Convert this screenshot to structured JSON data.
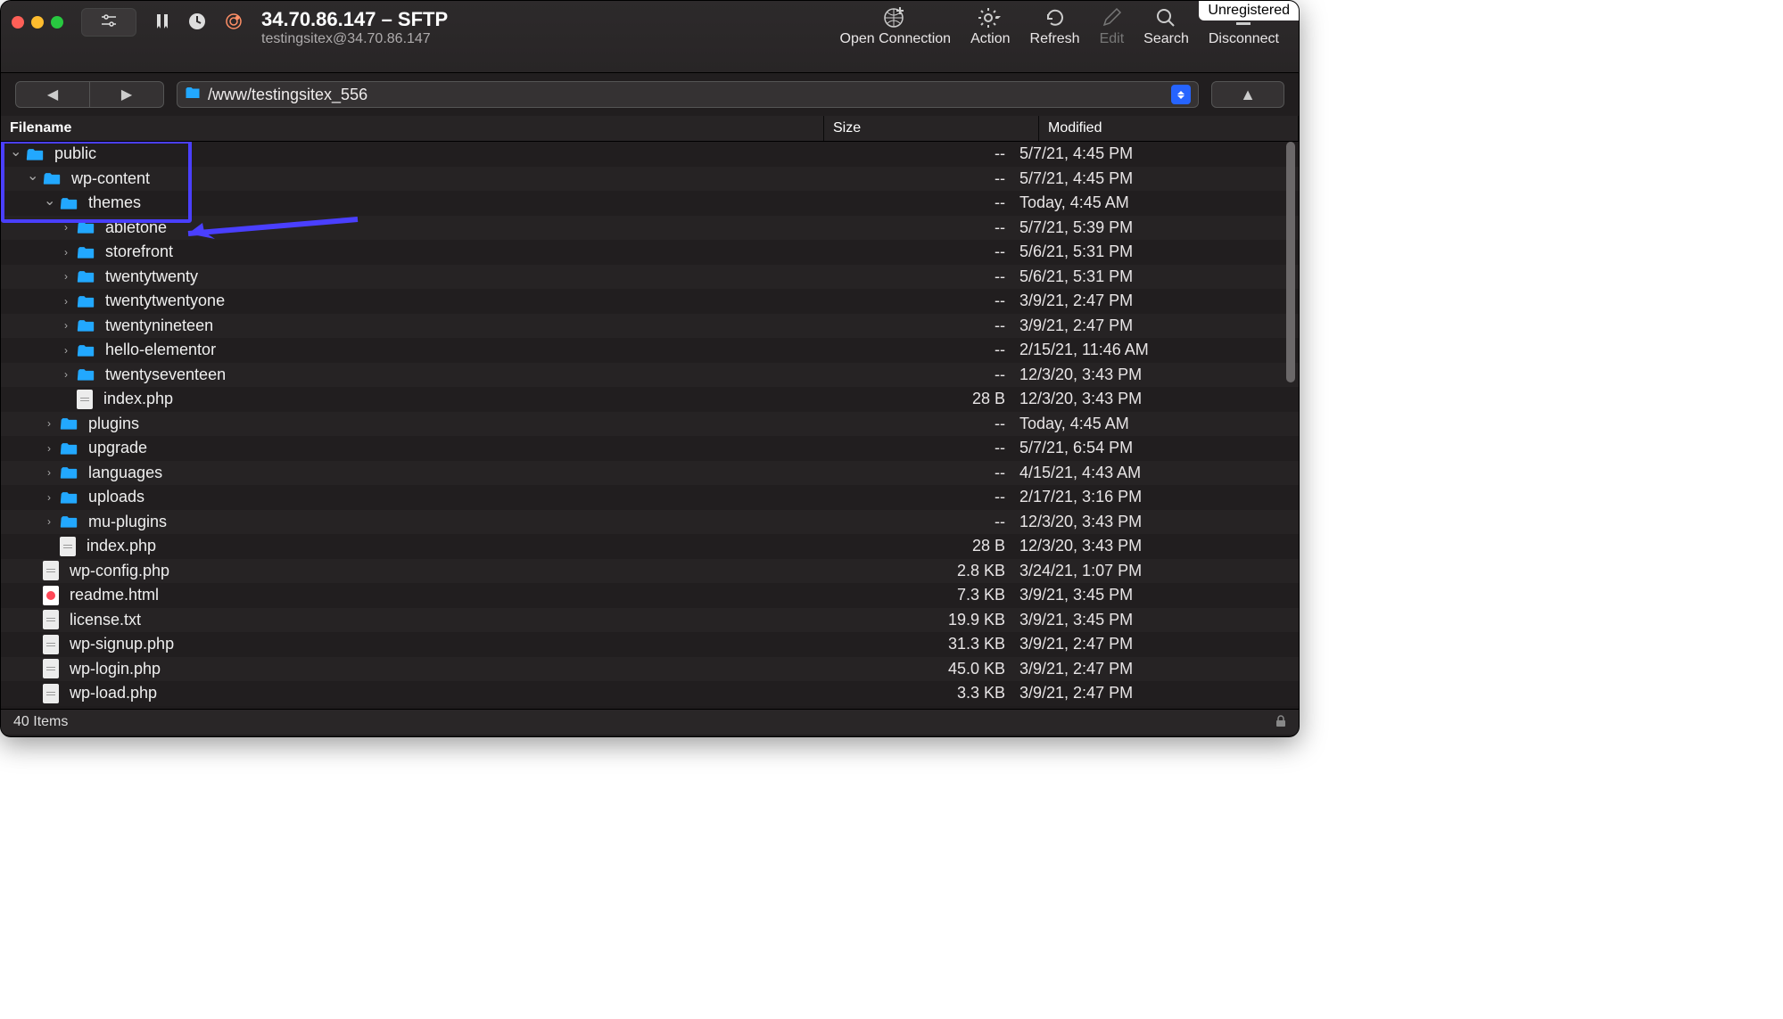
{
  "window": {
    "title": "34.70.86.147 – SFTP",
    "subtitle": "testingsitex@34.70.86.147",
    "unregistered": "Unregistered"
  },
  "toolbar": {
    "open_connection": "Open Connection",
    "action": "Action",
    "refresh": "Refresh",
    "edit": "Edit",
    "search": "Search",
    "disconnect": "Disconnect"
  },
  "path": "/www/testingsitex_556",
  "columns": {
    "filename": "Filename",
    "size": "Size",
    "modified": "Modified"
  },
  "rows": [
    {
      "indent": 0,
      "chev": "down",
      "type": "folder",
      "name": "public",
      "size": "--",
      "modified": "5/7/21, 4:45 PM"
    },
    {
      "indent": 1,
      "chev": "down",
      "type": "folder",
      "name": "wp-content",
      "size": "--",
      "modified": "5/7/21, 4:45 PM"
    },
    {
      "indent": 2,
      "chev": "down",
      "type": "folder",
      "name": "themes",
      "size": "--",
      "modified": "Today, 4:45 AM"
    },
    {
      "indent": 3,
      "chev": "right",
      "type": "folder",
      "name": "abletone",
      "size": "--",
      "modified": "5/7/21, 5:39 PM"
    },
    {
      "indent": 3,
      "chev": "right",
      "type": "folder",
      "name": "storefront",
      "size": "--",
      "modified": "5/6/21, 5:31 PM"
    },
    {
      "indent": 3,
      "chev": "right",
      "type": "folder",
      "name": "twentytwenty",
      "size": "--",
      "modified": "5/6/21, 5:31 PM"
    },
    {
      "indent": 3,
      "chev": "right",
      "type": "folder",
      "name": "twentytwentyone",
      "size": "--",
      "modified": "3/9/21, 2:47 PM"
    },
    {
      "indent": 3,
      "chev": "right",
      "type": "folder",
      "name": "twentynineteen",
      "size": "--",
      "modified": "3/9/21, 2:47 PM"
    },
    {
      "indent": 3,
      "chev": "right",
      "type": "folder",
      "name": "hello-elementor",
      "size": "--",
      "modified": "2/15/21, 11:46 AM"
    },
    {
      "indent": 3,
      "chev": "right",
      "type": "folder",
      "name": "twentyseventeen",
      "size": "--",
      "modified": "12/3/20, 3:43 PM"
    },
    {
      "indent": 3,
      "chev": "none",
      "type": "file",
      "name": "index.php",
      "size": "28 B",
      "modified": "12/3/20, 3:43 PM"
    },
    {
      "indent": 2,
      "chev": "right",
      "type": "folder",
      "name": "plugins",
      "size": "--",
      "modified": "Today, 4:45 AM"
    },
    {
      "indent": 2,
      "chev": "right",
      "type": "folder",
      "name": "upgrade",
      "size": "--",
      "modified": "5/7/21, 6:54 PM"
    },
    {
      "indent": 2,
      "chev": "right",
      "type": "folder",
      "name": "languages",
      "size": "--",
      "modified": "4/15/21, 4:43 AM"
    },
    {
      "indent": 2,
      "chev": "right",
      "type": "folder",
      "name": "uploads",
      "size": "--",
      "modified": "2/17/21, 3:16 PM"
    },
    {
      "indent": 2,
      "chev": "right",
      "type": "folder",
      "name": "mu-plugins",
      "size": "--",
      "modified": "12/3/20, 3:43 PM"
    },
    {
      "indent": 2,
      "chev": "none",
      "type": "file",
      "name": "index.php",
      "size": "28 B",
      "modified": "12/3/20, 3:43 PM"
    },
    {
      "indent": 1,
      "chev": "none",
      "type": "file",
      "name": "wp-config.php",
      "size": "2.8 KB",
      "modified": "3/24/21, 1:07 PM"
    },
    {
      "indent": 1,
      "chev": "none",
      "type": "html",
      "name": "readme.html",
      "size": "7.3 KB",
      "modified": "3/9/21, 3:45 PM"
    },
    {
      "indent": 1,
      "chev": "none",
      "type": "file",
      "name": "license.txt",
      "size": "19.9 KB",
      "modified": "3/9/21, 3:45 PM"
    },
    {
      "indent": 1,
      "chev": "none",
      "type": "file",
      "name": "wp-signup.php",
      "size": "31.3 KB",
      "modified": "3/9/21, 2:47 PM"
    },
    {
      "indent": 1,
      "chev": "none",
      "type": "file",
      "name": "wp-login.php",
      "size": "45.0 KB",
      "modified": "3/9/21, 2:47 PM"
    },
    {
      "indent": 1,
      "chev": "none",
      "type": "file",
      "name": "wp-load.php",
      "size": "3.3 KB",
      "modified": "3/9/21, 2:47 PM"
    }
  ],
  "status": {
    "count": "40 Items"
  },
  "annotation": {
    "highlight_rows": [
      0,
      1,
      2
    ],
    "arrow_to_row": 3
  }
}
